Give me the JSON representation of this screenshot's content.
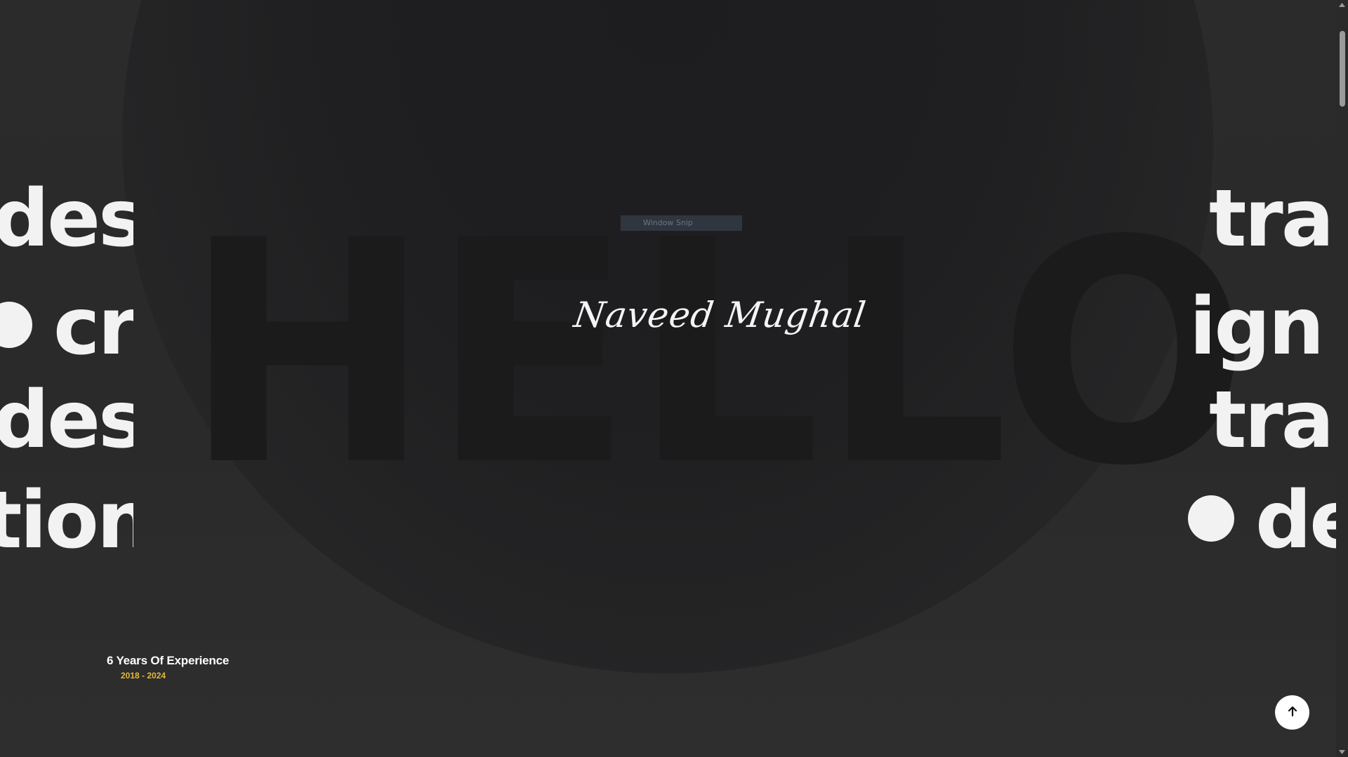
{
  "hero": {
    "big_word": "HELLO",
    "signature": "Naveed Mughal",
    "snip_label": "Window Snip"
  },
  "marquee": {
    "left": {
      "row1": "desi",
      "row2": "cr",
      "row3": "desi",
      "row4": "tion"
    },
    "right": {
      "row1": "tra",
      "row2": "ign",
      "row3": "tra",
      "row4": "de"
    }
  },
  "experience": {
    "title": "6 Years Of Experience",
    "years": "2018 - 2024"
  },
  "controls": {
    "to_top_icon": "arrow-up-icon"
  },
  "colors": {
    "background": "#2a2a2b",
    "text": "#f2f2f2",
    "accent": "#e3b93c",
    "hello": "#1b1b1c"
  }
}
